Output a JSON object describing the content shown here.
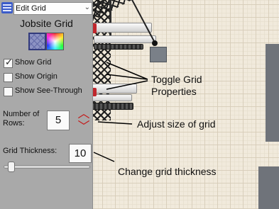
{
  "toolbar": {
    "menu_icon": "hamburger-menu-icon",
    "dropdown_value": "Edit Grid",
    "dropdown_chevron": "⌄"
  },
  "panel": {
    "title": "Jobsite Grid",
    "mode_buttons": [
      {
        "name": "grid-pattern-icon",
        "selected": true
      },
      {
        "name": "color-wheel-icon",
        "selected": false
      }
    ],
    "checkboxes": [
      {
        "label": "Show Grid",
        "checked": true
      },
      {
        "label": "Show Origin",
        "checked": false
      },
      {
        "label": "Show See-Through",
        "checked": false
      }
    ],
    "rows": {
      "label_line1": "Number of",
      "label_line2": "Rows:",
      "value": "5",
      "up_glyph": "︿",
      "down_glyph": "﹀"
    },
    "thickness": {
      "label": "Grid Thickness:",
      "value": "10",
      "slider_level": 0.1
    }
  },
  "annotations": {
    "toggle_line1": "Toggle Grid",
    "toggle_line2": "Properties",
    "rows_note": "Adjust size of grid",
    "thickness_note": "Change grid thickness"
  },
  "colors": {
    "panel_bg": "#a9a9a9",
    "stepper_red": "#c41a1a",
    "menu_blue": "#3c5cc9",
    "floor": "#f1eadc"
  }
}
